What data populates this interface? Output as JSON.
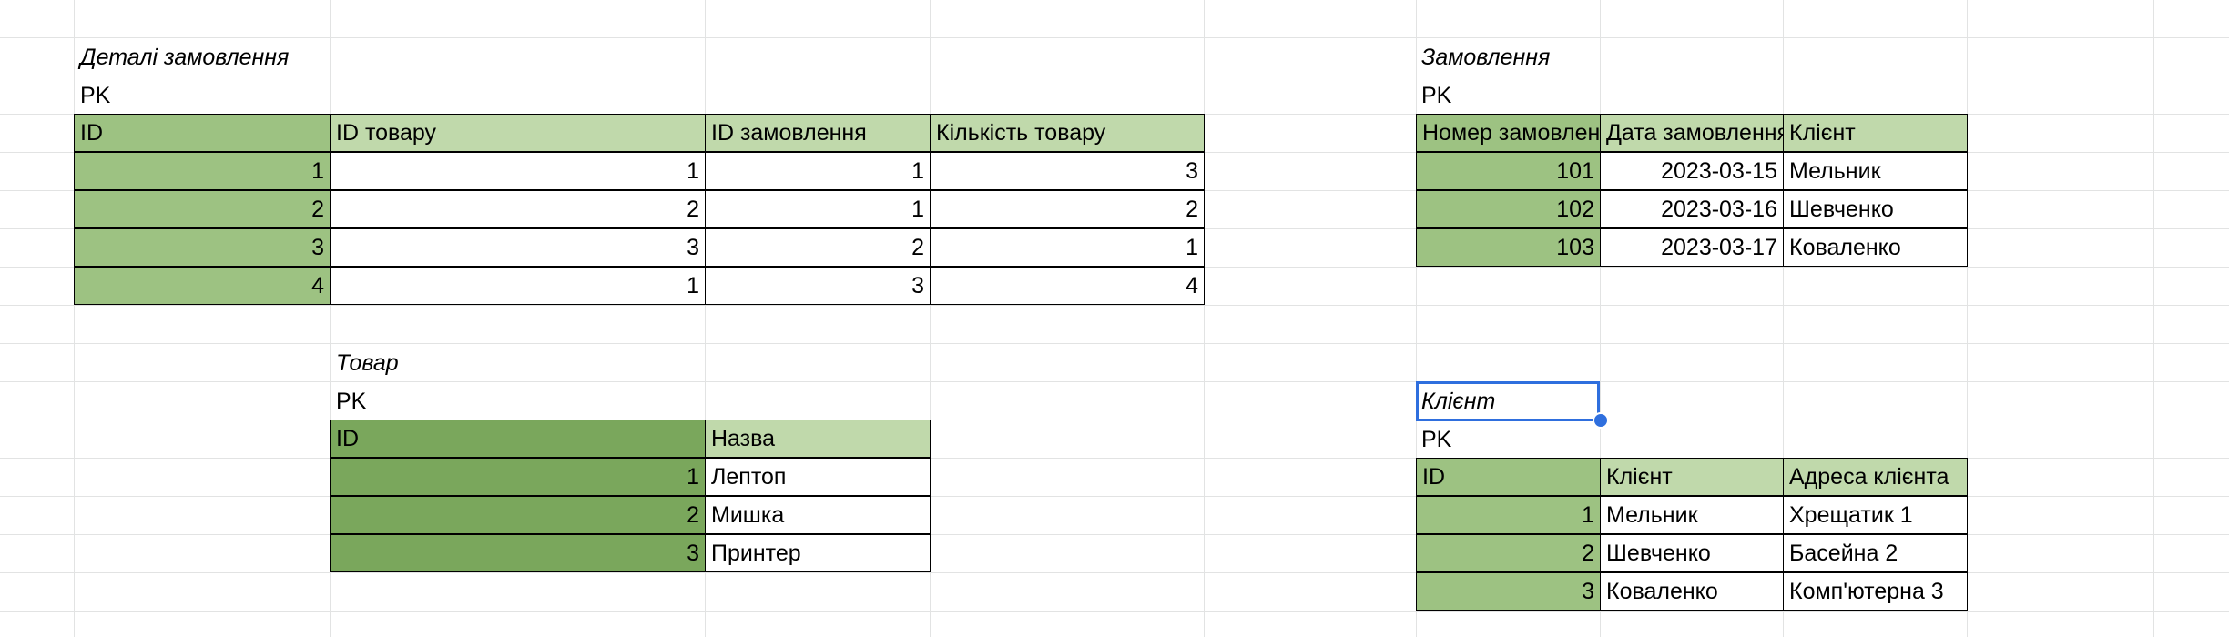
{
  "order_details": {
    "title": "Деталі замовлення",
    "pk": "PK",
    "headers": [
      "ID",
      "ID товару",
      "ID замовлення",
      "Кількість товару"
    ],
    "rows": [
      [
        "1",
        "1",
        "1",
        "3"
      ],
      [
        "2",
        "2",
        "1",
        "2"
      ],
      [
        "3",
        "3",
        "2",
        "1"
      ],
      [
        "4",
        "1",
        "3",
        "4"
      ]
    ]
  },
  "orders": {
    "title": "Замовлення",
    "pk": "PK",
    "headers": [
      "Номер замовлення",
      "Дата замовлення",
      "Клієнт"
    ],
    "rows": [
      [
        "101",
        "2023-03-15",
        "Мельник"
      ],
      [
        "102",
        "2023-03-16",
        "Шевченко"
      ],
      [
        "103",
        "2023-03-17",
        "Коваленко"
      ]
    ]
  },
  "product": {
    "title": "Товар",
    "pk": "PK",
    "headers": [
      "ID",
      "Назва"
    ],
    "rows": [
      [
        "1",
        "Лептоп"
      ],
      [
        "2",
        "Мишка"
      ],
      [
        "3",
        "Принтер"
      ]
    ]
  },
  "client": {
    "title": "Клієнт",
    "pk": "PK",
    "headers": [
      "ID",
      "Клієнт",
      "Адреса клієнта"
    ],
    "rows": [
      [
        "1",
        "Мельник",
        "Хрещатик 1"
      ],
      [
        "2",
        "Шевченко",
        "Басейна 2"
      ],
      [
        "3",
        "Коваленко",
        "Комп'ютерна 3"
      ]
    ]
  },
  "colors": {
    "pk_cell": "#9dc282",
    "pk_cell_dark": "#7aa75c",
    "header_cell": "#c0d9ab",
    "selection": "#2f6fde"
  }
}
